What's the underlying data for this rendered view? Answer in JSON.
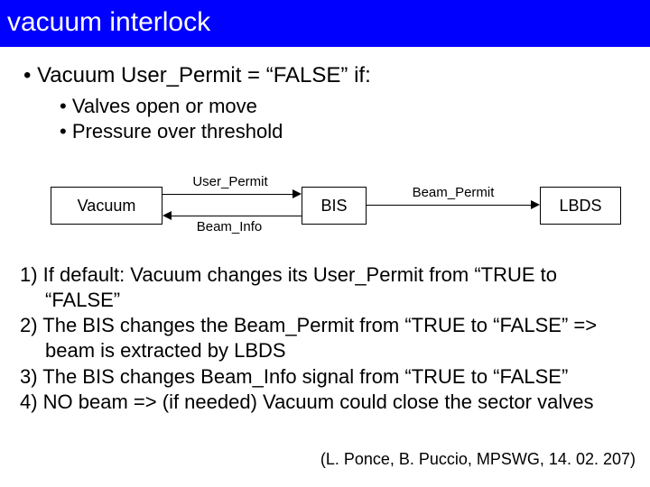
{
  "title": "vacuum interlock",
  "main_bullet": "Vacuum User_Permit = “FALSE” if:",
  "sub_bullets": [
    "Valves open or move",
    "Pressure over threshold"
  ],
  "diagram": {
    "box_vacuum": "Vacuum",
    "box_bis": "BIS",
    "box_lbds": "LBDS",
    "label_user_permit": "User_Permit",
    "label_beam_info": "Beam_Info",
    "label_beam_permit": "Beam_Permit"
  },
  "steps": [
    "1) If default: Vacuum changes its User_Permit  from “TRUE to “FALSE”",
    "2) The BIS changes the Beam_Permit from “TRUE to “FALSE” => beam is extracted by LBDS",
    "3) The BIS changes Beam_Info signal from “TRUE to “FALSE”",
    "4) NO beam  => (if needed) Vacuum could close the sector valves"
  ],
  "citation": "(L. Ponce, B. Puccio,  MPSWG, 14. 02. 207)"
}
